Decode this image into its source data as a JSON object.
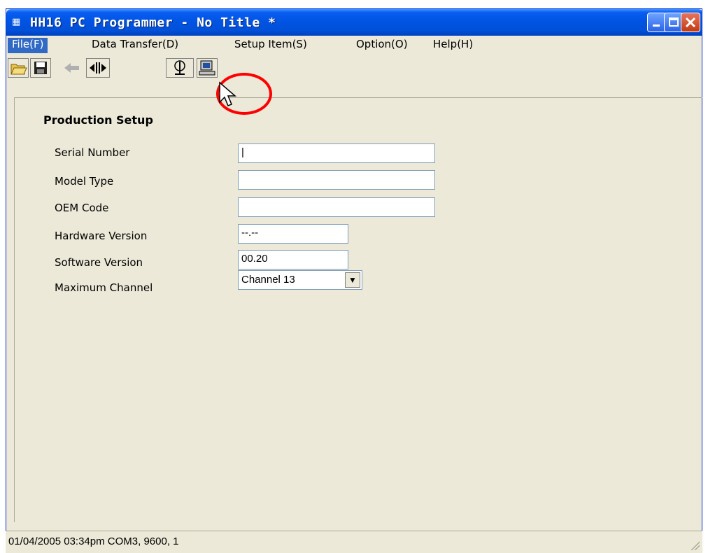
{
  "window": {
    "title": "HH16 PC Programmer - No Title *",
    "icon": "app-icon"
  },
  "menubar": {
    "items": [
      {
        "label": "File(F)",
        "active": true
      },
      {
        "label": "Data Transfer(D)"
      },
      {
        "label": "Setup Item(S)"
      },
      {
        "label": "Option(O)"
      },
      {
        "label": "Help(H)"
      }
    ]
  },
  "toolbar": {
    "icons": [
      "open-folder-icon",
      "save-icon",
      "back-arrow-icon",
      "connect-icon",
      "antenna-icon",
      "computer-icon"
    ]
  },
  "form": {
    "section_title": "Production Setup",
    "fields": [
      {
        "label": "Serial Number",
        "value": "|"
      },
      {
        "label": "Model Type",
        "value": ""
      },
      {
        "label": "OEM Code",
        "value": ""
      },
      {
        "label": "Hardware Version",
        "value": "--.--"
      },
      {
        "label": "Software Version",
        "value": "00.20"
      },
      {
        "label": "Maximum Channel",
        "value": "Channel 13"
      }
    ]
  },
  "statusbar": {
    "text": "01/04/2005 03:34pm COM3, 9600, 1"
  },
  "colors": {
    "titlebar": "#0054e3",
    "menu_active": "#316ac5",
    "highlight_circle": "#ff0000",
    "window_bg": "#ece9d8"
  }
}
